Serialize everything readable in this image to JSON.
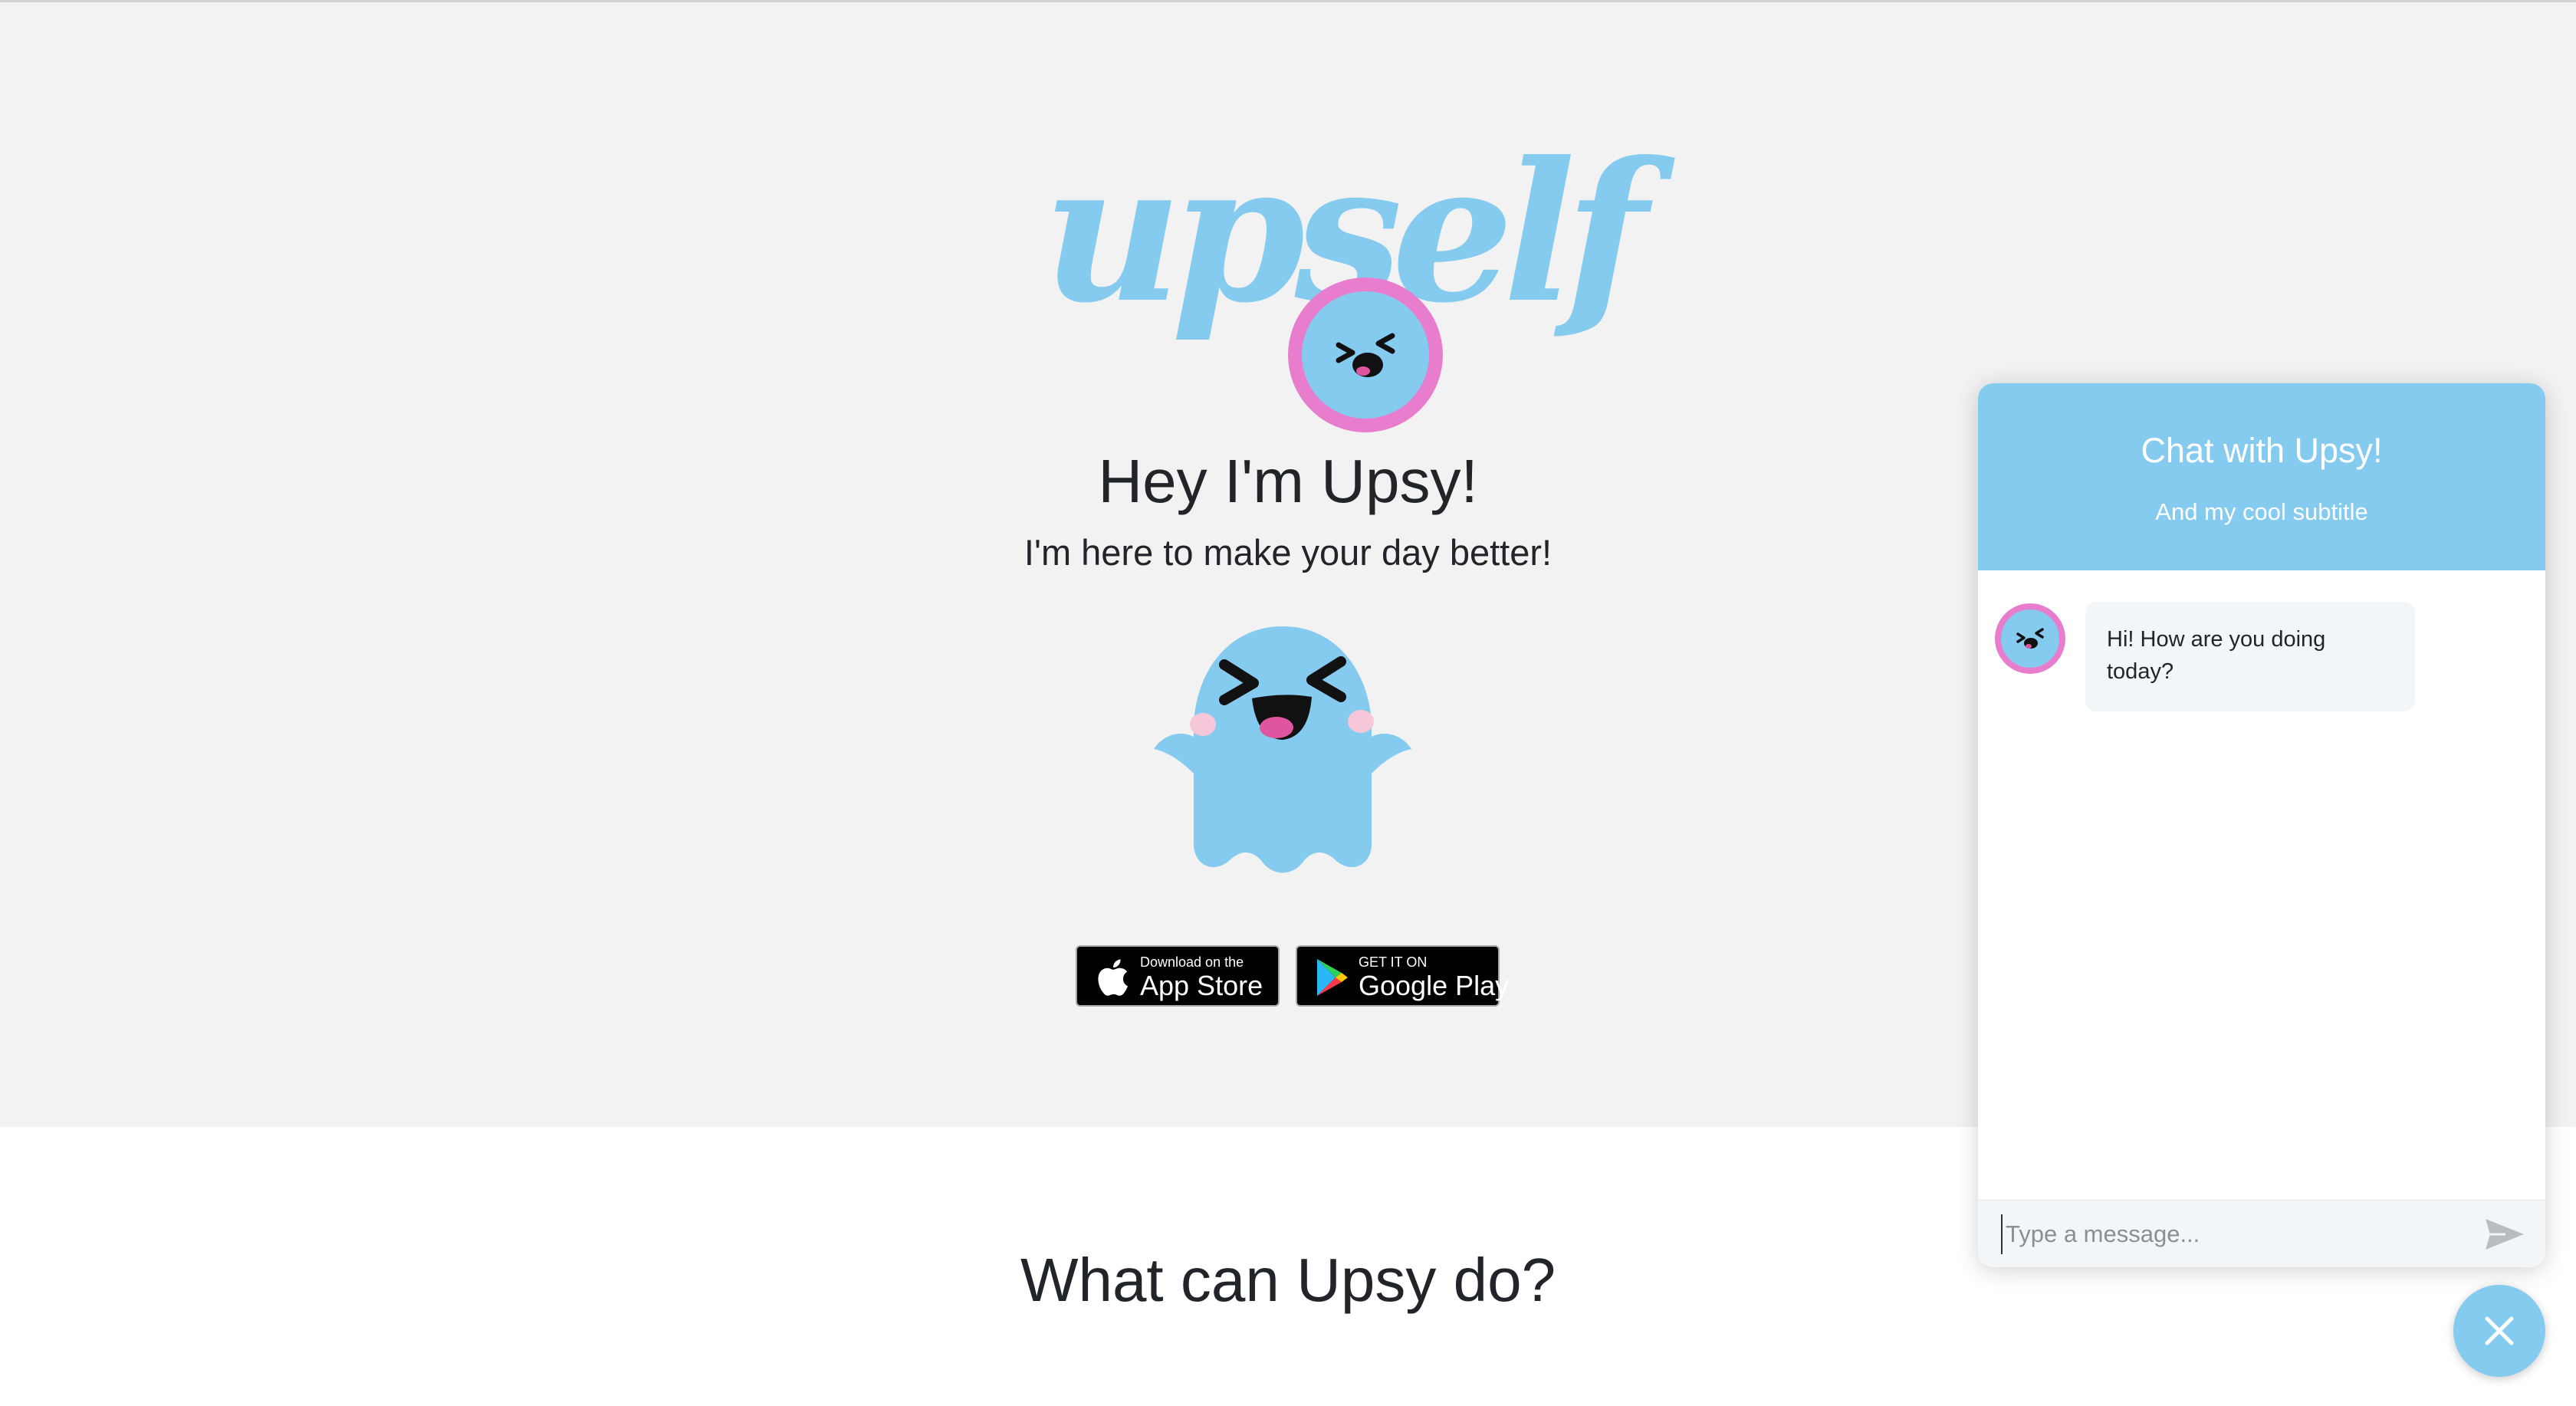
{
  "brand": {
    "logo_text": "upself",
    "accent_color": "#85cbef",
    "avatar_ring_color": "#e77dcc"
  },
  "hero": {
    "title": "Hey I'm Upsy!",
    "subtitle": "I'm here to make your day better!",
    "mascot_icon": "ghost-mascot-icon"
  },
  "badges": {
    "app_store": {
      "small": "Download on the",
      "big": "App Store",
      "icon": "apple-icon"
    },
    "google_play": {
      "small": "GET IT ON",
      "big": "Google Play",
      "icon": "play-store-icon"
    }
  },
  "section": {
    "title": "What can Upsy do?"
  },
  "chat": {
    "title": "Chat with Upsy!",
    "subtitle": "And my cool subtitle",
    "messages": [
      {
        "sender": "Upsy",
        "text": "Hi! How are you doing today?"
      }
    ],
    "input_placeholder": "Type a message...",
    "send_icon": "send-icon",
    "close_icon": "close-icon"
  }
}
